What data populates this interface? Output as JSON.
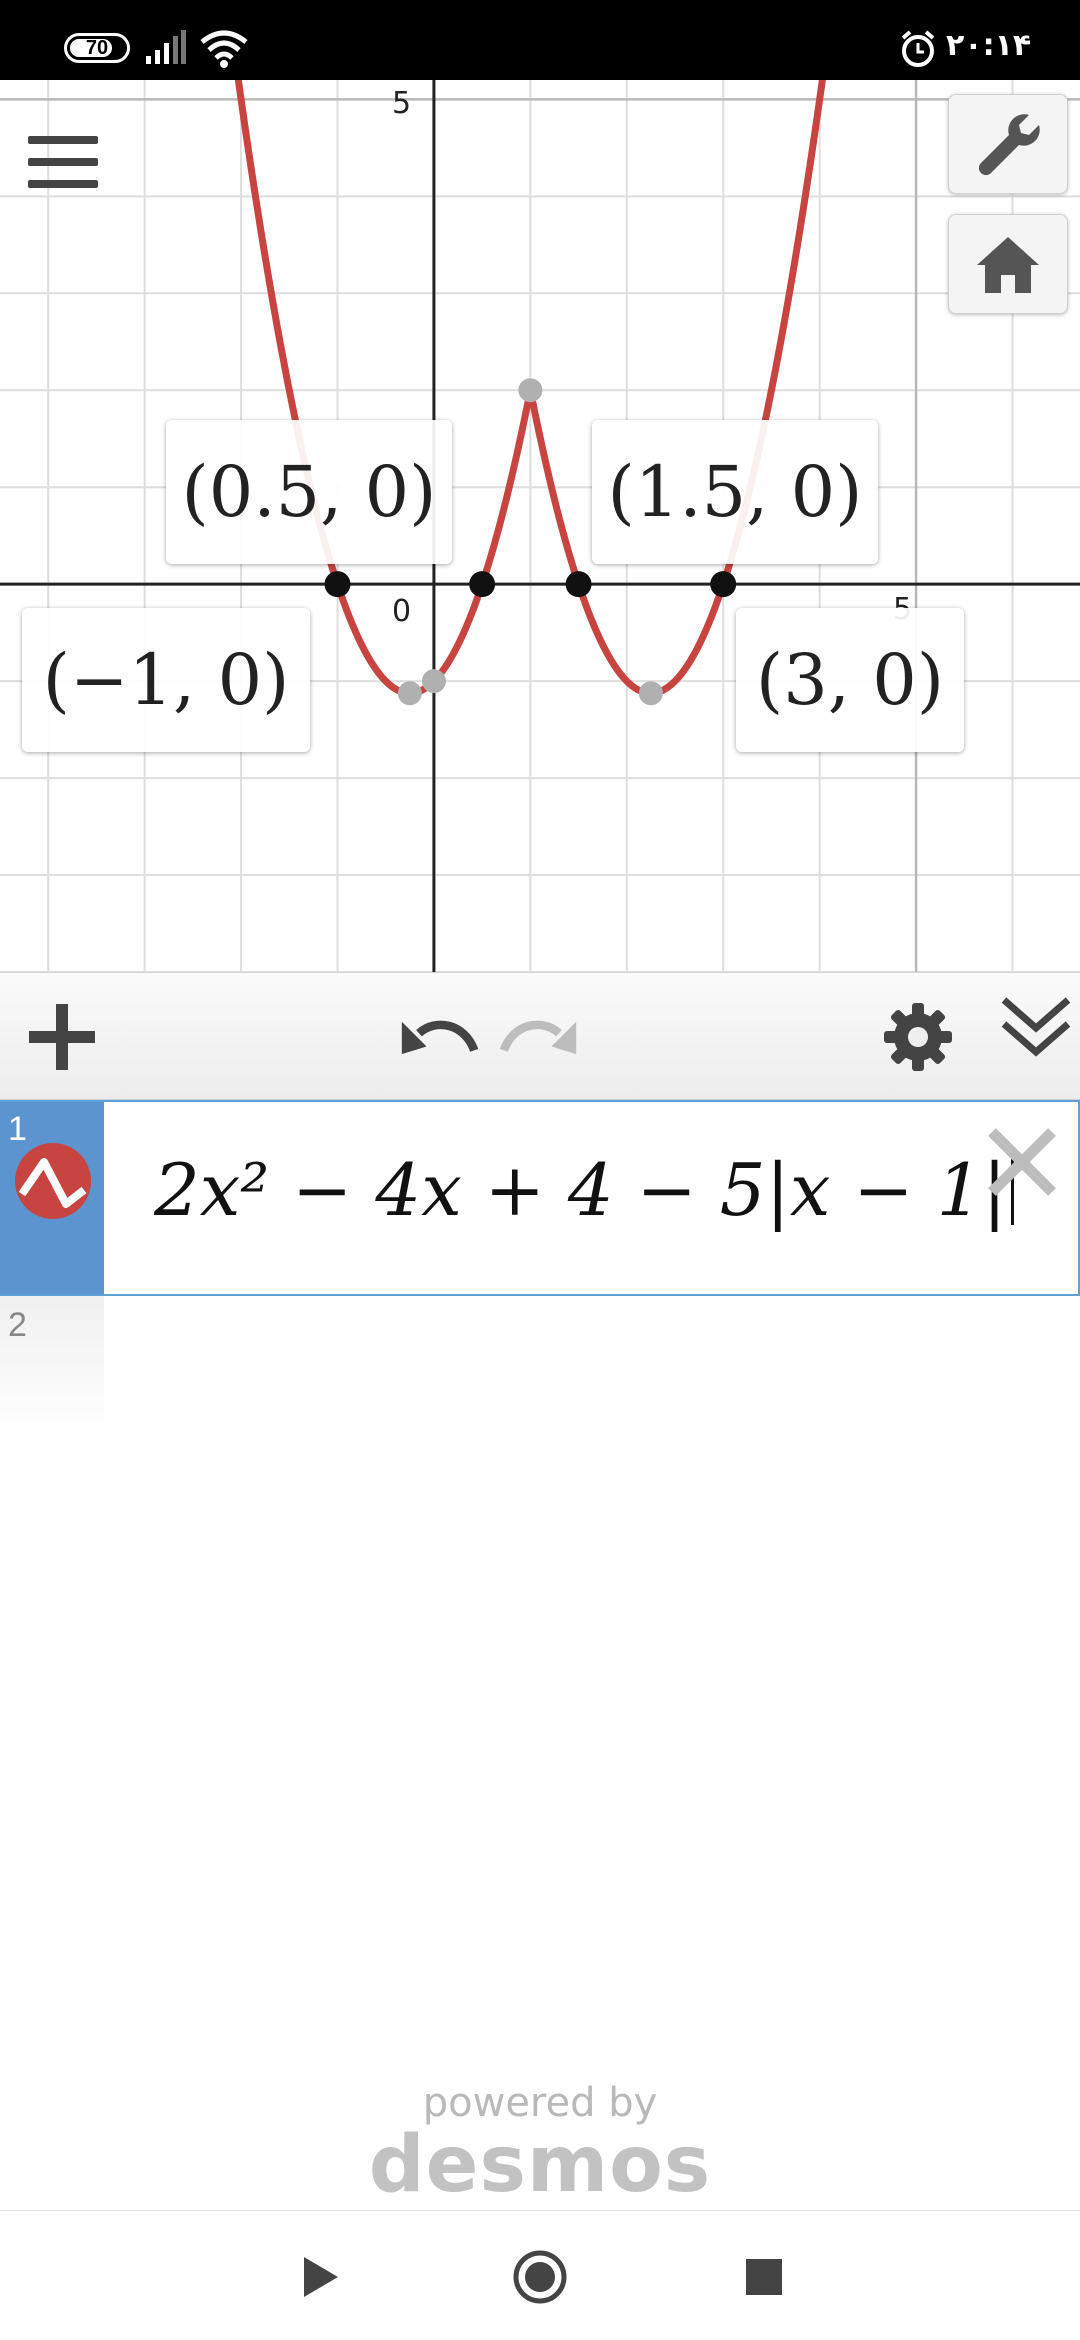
{
  "status_bar": {
    "battery": "70",
    "time": "۲۰:۱۴",
    "icons": [
      "signal-icon",
      "wifi-icon",
      "alarm-icon"
    ]
  },
  "graph": {
    "axis_labels": {
      "y_top": "5",
      "x_right": "5",
      "origin": "0"
    },
    "curve_color": "#c74440",
    "point_labels": [
      "(0.5, 0)",
      "(1.5, 0)",
      "(−1, 0)",
      "(3, 0)"
    ],
    "buttons": [
      "menu-icon",
      "wrench-icon",
      "home-icon"
    ]
  },
  "toolbar": {
    "icons": [
      "add-icon",
      "undo-icon",
      "redo-icon",
      "gear-icon",
      "collapse-icon"
    ]
  },
  "expressions": [
    {
      "index": "1",
      "latex": "2x² − 4x + 4 − 5|x − 1|",
      "color": "#c74440"
    },
    {
      "index": "2",
      "latex": ""
    }
  ],
  "branding": {
    "powered_by": "powered by",
    "logo": "desmos"
  },
  "nav_bar": {
    "icons": [
      "play-icon",
      "record-icon",
      "stop-icon"
    ]
  },
  "chart_data": {
    "type": "line",
    "series": [
      {
        "name": "2x² − 4x + 4 − 5|x − 1|",
        "color": "#c74440"
      }
    ],
    "xlim": [
      -4.5,
      6.7
    ],
    "ylim": [
      -4.0,
      5.2
    ],
    "grid": true,
    "x_intercepts": [
      [
        -1,
        0
      ],
      [
        0.5,
        0
      ],
      [
        1.5,
        0
      ],
      [
        3,
        0
      ]
    ],
    "extrema": [
      [
        -0.25,
        -1.125
      ],
      [
        1,
        2
      ],
      [
        2.25,
        -1.125
      ]
    ],
    "y_intercept": [
      0,
      -1
    ]
  }
}
